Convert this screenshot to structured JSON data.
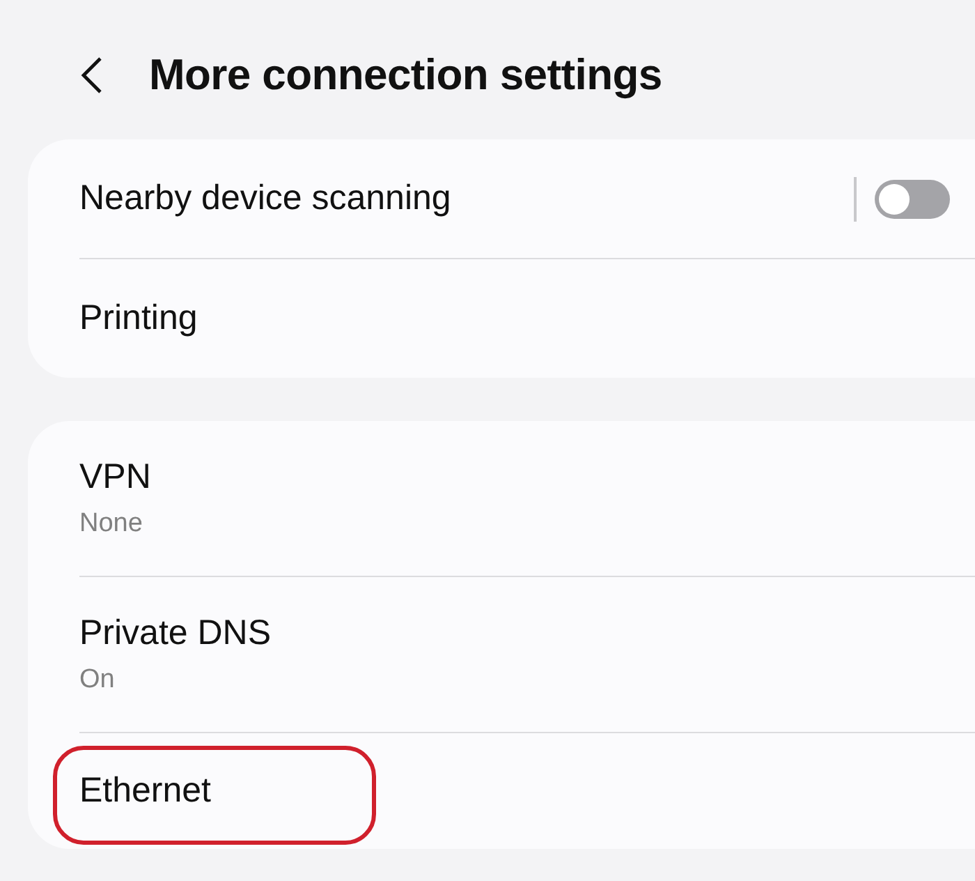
{
  "header": {
    "title": "More connection settings"
  },
  "groups": [
    {
      "items": [
        {
          "kind": "toggle",
          "label": "Nearby device scanning",
          "on": false
        },
        {
          "kind": "link",
          "label": "Printing"
        }
      ]
    },
    {
      "items": [
        {
          "kind": "link",
          "label": "VPN",
          "summary": "None"
        },
        {
          "kind": "link",
          "label": "Private DNS",
          "summary": "On"
        },
        {
          "kind": "link",
          "label": "Ethernet",
          "highlighted": true
        }
      ]
    }
  ]
}
